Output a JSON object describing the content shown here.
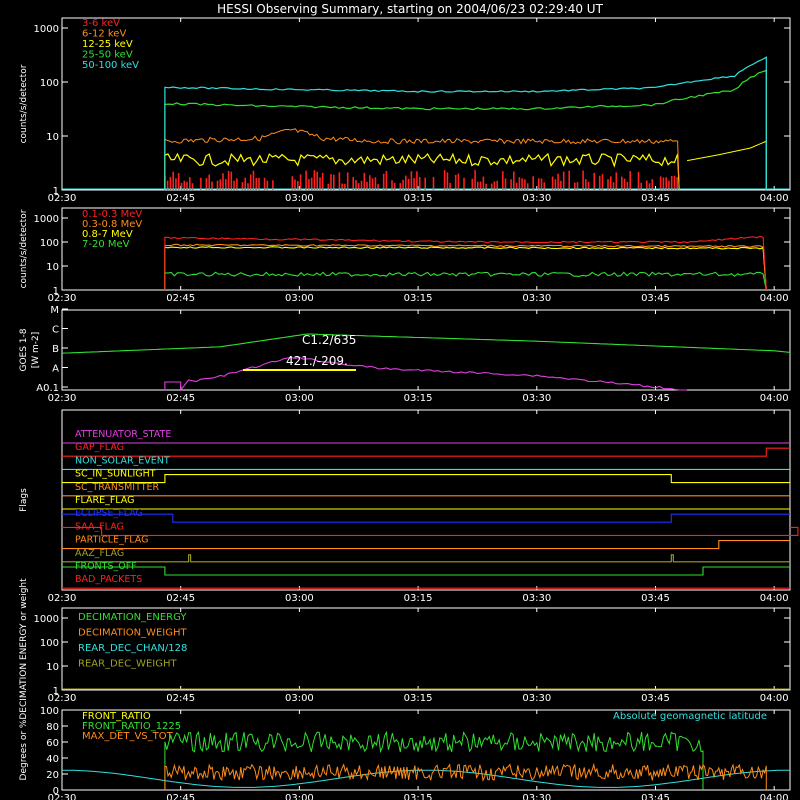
{
  "title": "HESSI Observing Summary, starting on 2004/06/23 02:29:40 UT",
  "time_ticks": [
    "02:30",
    "02:45",
    "03:00",
    "03:15",
    "03:30",
    "03:45",
    "04:00"
  ],
  "colors": {
    "red": "#ff2020",
    "orange": "#ff8c1a",
    "yellow": "#ffff00",
    "green": "#30e030",
    "cyan": "#30e0e0",
    "magenta": "#e040e0",
    "blue": "#2030ff",
    "olive": "#a0a020",
    "white": "#ffffff",
    "gray": "#b0b0b0"
  },
  "chart_data": [
    {
      "type": "line",
      "panel": "lightcurve-low",
      "ylabel": "counts/s/detector",
      "scale": "log",
      "ylim": [
        1,
        1000
      ],
      "yticks": [
        "1",
        "10",
        "100",
        "1000"
      ],
      "xlim": [
        "02:30",
        "04:02"
      ],
      "series": [
        {
          "name": "3-6 keV",
          "color": "#ff2020",
          "x": [
            "02:43",
            "03:48"
          ],
          "y": [
            1.6,
            1.6
          ]
        },
        {
          "name": "6-12 keV",
          "color": "#ff8c1a",
          "x": [
            "02:43",
            "02:55",
            "02:59",
            "03:03",
            "03:10",
            "03:48"
          ],
          "y": [
            8,
            9,
            13,
            9,
            8,
            8
          ]
        },
        {
          "name": "12-25 keV",
          "color": "#ffff00",
          "x": [
            "02:43",
            "03:48"
          ],
          "y": [
            3.6,
            3.6
          ]
        },
        {
          "name": "25-50 keV",
          "color": "#30e030",
          "x": [
            "02:43",
            "02:55",
            "03:15",
            "03:30",
            "03:45",
            "03:55",
            "03:59"
          ],
          "y": [
            40,
            36,
            32,
            32,
            38,
            70,
            170
          ]
        },
        {
          "name": "50-100 keV",
          "color": "#30e0e0",
          "x": [
            "02:43",
            "02:55",
            "03:15",
            "03:30",
            "03:45",
            "03:55",
            "03:59"
          ],
          "y": [
            80,
            74,
            67,
            67,
            78,
            130,
            280
          ]
        }
      ]
    },
    {
      "type": "line",
      "panel": "lightcurve-high",
      "ylabel": "counts/s/detector",
      "scale": "log",
      "ylim": [
        1,
        1000
      ],
      "yticks": [
        "1",
        "10",
        "100",
        "1000"
      ],
      "series": [
        {
          "name": "0.1-0.3 MeV",
          "color": "#ff2020",
          "x": [
            "02:43",
            "03:20",
            "03:50",
            "03:59"
          ],
          "y": [
            150,
            100,
            100,
            170
          ]
        },
        {
          "name": "0.3-0.8 MeV",
          "color": "#ff8c1a",
          "x": [
            "02:43",
            "03:59"
          ],
          "y": [
            75,
            65
          ]
        },
        {
          "name": "0.8-7 MeV",
          "color": "#ffff00",
          "x": [
            "02:43",
            "03:59"
          ],
          "y": [
            60,
            55
          ]
        },
        {
          "name": "7-20 MeV",
          "color": "#30e030",
          "x": [
            "02:43",
            "03:59"
          ],
          "y": [
            4.5,
            4.5
          ]
        }
      ]
    },
    {
      "type": "line",
      "panel": "goes",
      "ylabel": "GOES 1-8",
      "ylabel_unit": "[W m-2]",
      "yticks": [
        "A0.1",
        "A",
        "B",
        "C",
        "M"
      ],
      "annotations": [
        "C1.2/635",
        "421./-209."
      ],
      "series": [
        {
          "name": "GOES high",
          "color": "#30e030",
          "x": [
            "02:30",
            "02:50",
            "03:01",
            "03:30",
            "04:00",
            "04:02"
          ],
          "y": [
            0.46,
            0.54,
            0.7,
            0.61,
            0.49,
            0.47
          ]
        },
        {
          "name": "GOES low",
          "color": "#e040e0",
          "x": [
            "02:44",
            "02:50",
            "02:59",
            "03:10",
            "03:30",
            "03:49"
          ],
          "y": [
            0.06,
            0.17,
            0.41,
            0.27,
            0.18,
            0.0
          ]
        }
      ]
    },
    {
      "type": "line",
      "panel": "flags",
      "ylabel": "Flags",
      "flags": [
        {
          "name": "ATTENUATOR_STATE",
          "color": "#e040e0"
        },
        {
          "name": "GAP_FLAG",
          "color": "#ff2020"
        },
        {
          "name": "NON_SOLAR_EVENT",
          "color": "#30e0e0"
        },
        {
          "name": "SC_IN_SUNLIGHT",
          "color": "#ffff00"
        },
        {
          "name": "SC_TRANSMITTER",
          "color": "#ff8c1a"
        },
        {
          "name": "FLARE_FLAG",
          "color": "#ffff00"
        },
        {
          "name": "ECLIPSE_FLAG",
          "color": "#2030ff"
        },
        {
          "name": "SAA_FLAG",
          "color": "#ff2020"
        },
        {
          "name": "PARTICLE_FLAG",
          "color": "#ff8c1a"
        },
        {
          "name": "AAZ_FLAG",
          "color": "#a0a020"
        },
        {
          "name": "FRONTS_OFF",
          "color": "#30e030"
        },
        {
          "name": "BAD_PACKETS",
          "color": "#ff2020"
        }
      ]
    },
    {
      "type": "line",
      "panel": "decimation",
      "ylabel": "DECIMATION ENERGY or weight",
      "scale": "log",
      "ylim": [
        1,
        1000
      ],
      "yticks": [
        "1",
        "10",
        "100",
        "1000"
      ],
      "series": [
        {
          "name": "DECIMATION_ENERGY",
          "color": "#30e030"
        },
        {
          "name": "DECIMATION_WEIGHT",
          "color": "#ff8c1a"
        },
        {
          "name": "REAR_DEC_CHAN/128",
          "color": "#30e0e0"
        },
        {
          "name": "REAR_DEC_WEIGHT",
          "color": "#a0a020"
        }
      ]
    },
    {
      "type": "line",
      "panel": "ratios",
      "ylabel": "Degrees or %",
      "ylim": [
        0,
        100
      ],
      "yticks": [
        "0",
        "20",
        "40",
        "60",
        "80",
        "100"
      ],
      "annotations": [
        "Absolute geomagnetic latitude"
      ],
      "series": [
        {
          "name": "FRONT_RATIO",
          "color": "#ffff00"
        },
        {
          "name": "FRONT_RATIO_1225",
          "color": "#30e030",
          "x": [
            "02:43",
            "03:51"
          ],
          "y": [
            60,
            60
          ]
        },
        {
          "name": "MAX_DET_VS_TOT",
          "color": "#ff8c1a",
          "x": [
            "02:43",
            "03:59"
          ],
          "y": [
            22,
            22
          ]
        }
      ]
    }
  ]
}
